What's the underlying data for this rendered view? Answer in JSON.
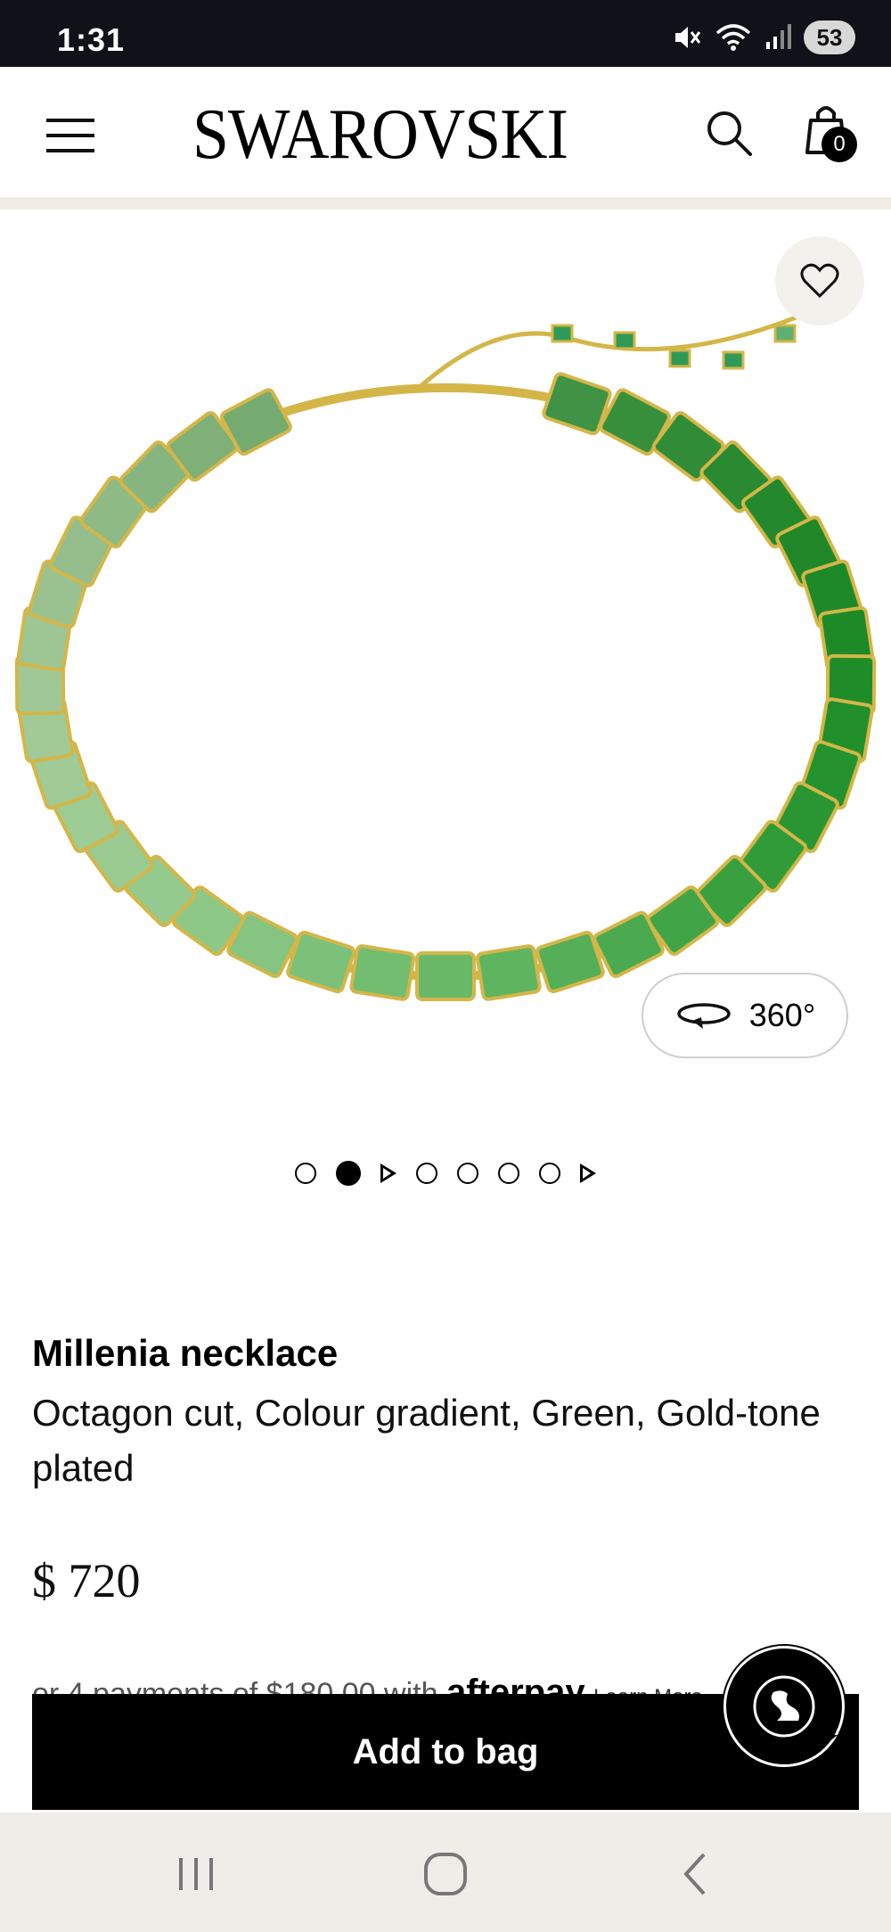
{
  "status_bar": {
    "time": "1:31",
    "battery": "53"
  },
  "header": {
    "logo": "SWAROVSKI",
    "bag_count": "0"
  },
  "gallery": {
    "rotate_label": "360°",
    "indicators": [
      "dot",
      "dot-active",
      "play",
      "dot",
      "dot",
      "dot",
      "dot",
      "play"
    ]
  },
  "product": {
    "name": "Millenia necklace",
    "description": "Octagon cut, Colour gradient, Green, Gold-tone plated",
    "price": "$ 720"
  },
  "payments": {
    "text": "or 4 payments of $180.00 with",
    "brand": "afterpay",
    "learn_more": "Learn More"
  },
  "cta": {
    "add_to_bag": "Add to bag"
  },
  "colors": {
    "accent": "#000000",
    "header_divider": "#f1ede4",
    "nav_bg": "#efede8",
    "status_bg": "#111119"
  }
}
